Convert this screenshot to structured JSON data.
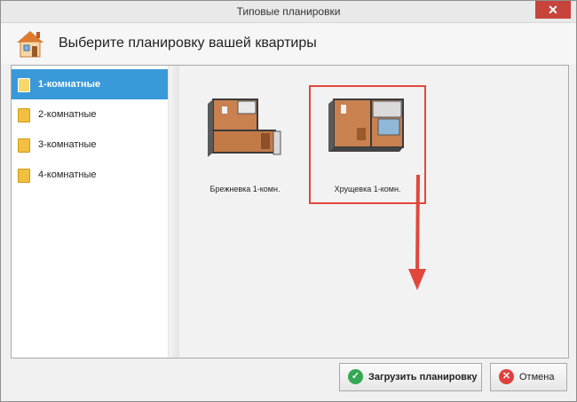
{
  "window": {
    "title": "Типовые планировки"
  },
  "header": {
    "title": "Выберите планировку вашей квартиры"
  },
  "sidebar": {
    "items": [
      {
        "label": "1-комнатные"
      },
      {
        "label": "2-комнатные"
      },
      {
        "label": "3-комнатные"
      },
      {
        "label": "4-комнатные"
      }
    ]
  },
  "plans": [
    {
      "label": "Брежневка 1-комн."
    },
    {
      "label": "Хрущевка 1-комн."
    }
  ],
  "footer": {
    "load_label": "Загрузить планировку",
    "cancel_label": "Отмена"
  },
  "colors": {
    "accent": "#3a99d8",
    "selection": "#e2473c",
    "ok": "#34a853",
    "cancel": "#e04040"
  }
}
